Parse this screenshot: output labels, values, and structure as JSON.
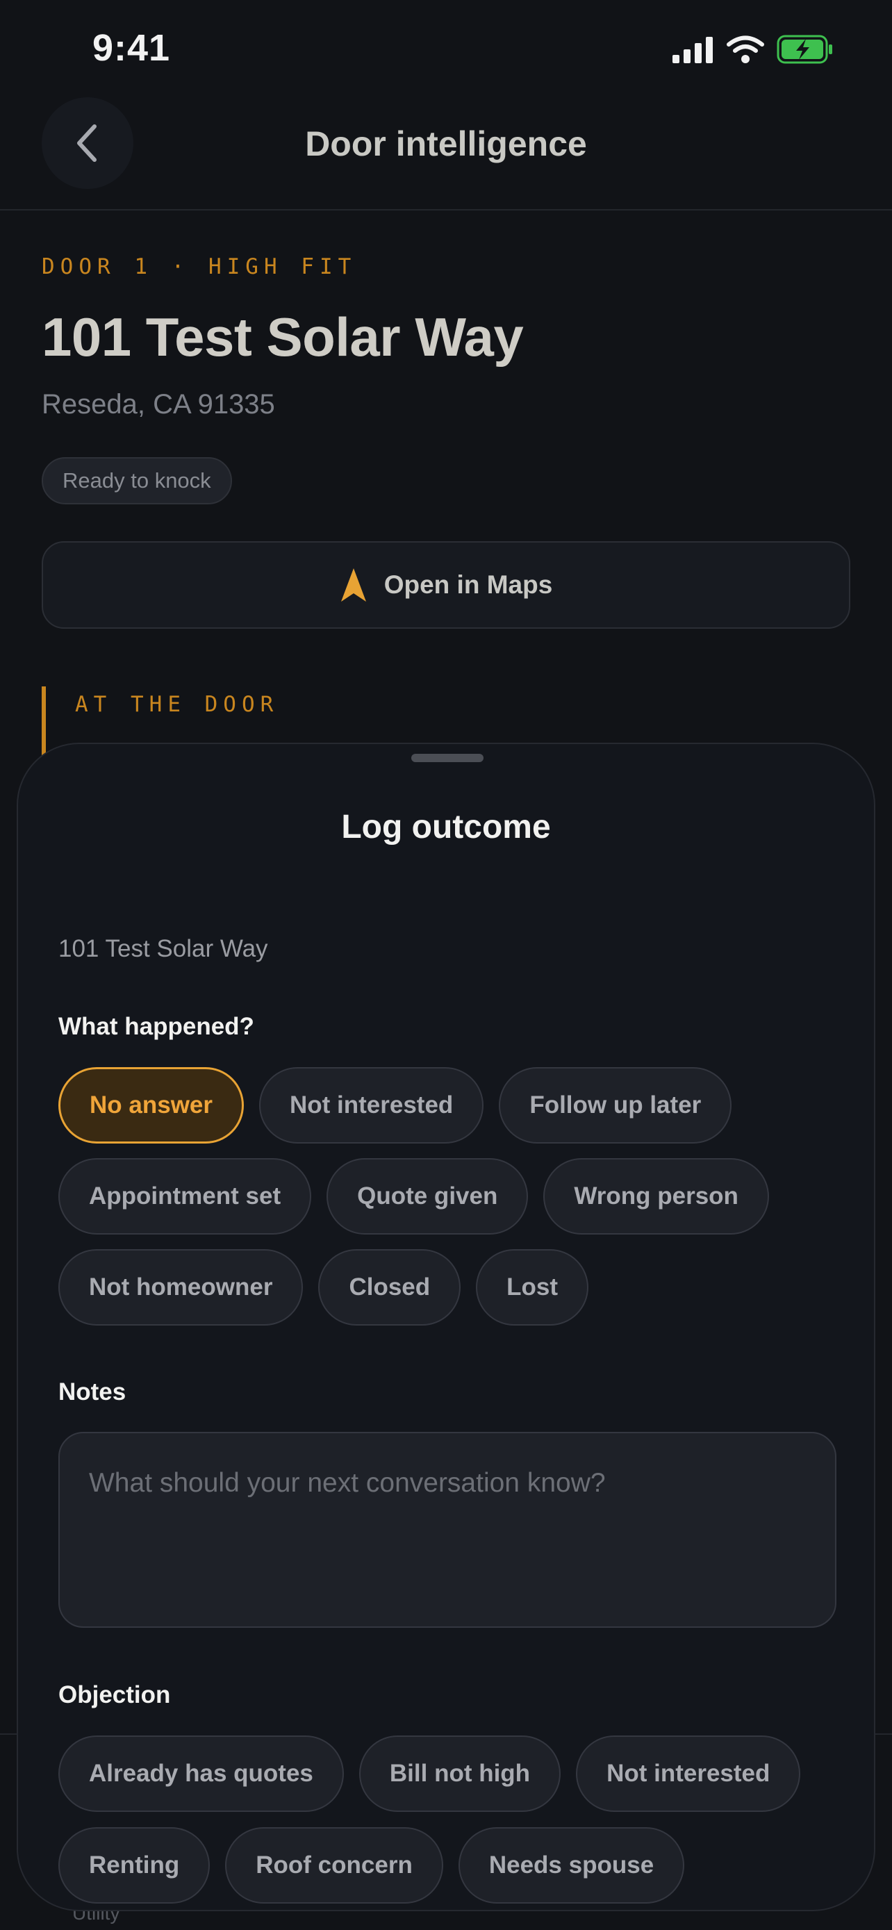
{
  "status": {
    "time": "9:41"
  },
  "nav": {
    "title": "Door intelligence"
  },
  "door": {
    "eyebrow": "DOOR 1 · HIGH FIT",
    "address": "101 Test Solar Way",
    "city": "Reseda, CA 91335",
    "status_chip": "Ready to knock",
    "maps_button": "Open in Maps",
    "section_label": "AT THE DOOR",
    "partial_text": "Utility"
  },
  "colors": {
    "accent": "#e8a334",
    "battery": "#3ec04f",
    "background": "#111317",
    "sheet": "#13161c"
  },
  "sheet": {
    "title": "Log outcome",
    "address": "101 Test Solar Way",
    "outcome_label": "What happened?",
    "outcomes": [
      {
        "label": "No answer",
        "selected": true
      },
      {
        "label": "Not interested",
        "selected": false
      },
      {
        "label": "Follow up later",
        "selected": false
      },
      {
        "label": "Appointment set",
        "selected": false
      },
      {
        "label": "Quote given",
        "selected": false
      },
      {
        "label": "Wrong person",
        "selected": false
      },
      {
        "label": "Not homeowner",
        "selected": false
      },
      {
        "label": "Closed",
        "selected": false
      },
      {
        "label": "Lost",
        "selected": false
      }
    ],
    "notes_label": "Notes",
    "notes_placeholder": "What should your next conversation know?",
    "objection_label": "Objection",
    "objections": [
      {
        "label": "Already has quotes"
      },
      {
        "label": "Bill not high"
      },
      {
        "label": "Not interested"
      },
      {
        "label": "Renting"
      },
      {
        "label": "Roof concern"
      },
      {
        "label": "Needs spouse"
      }
    ]
  }
}
